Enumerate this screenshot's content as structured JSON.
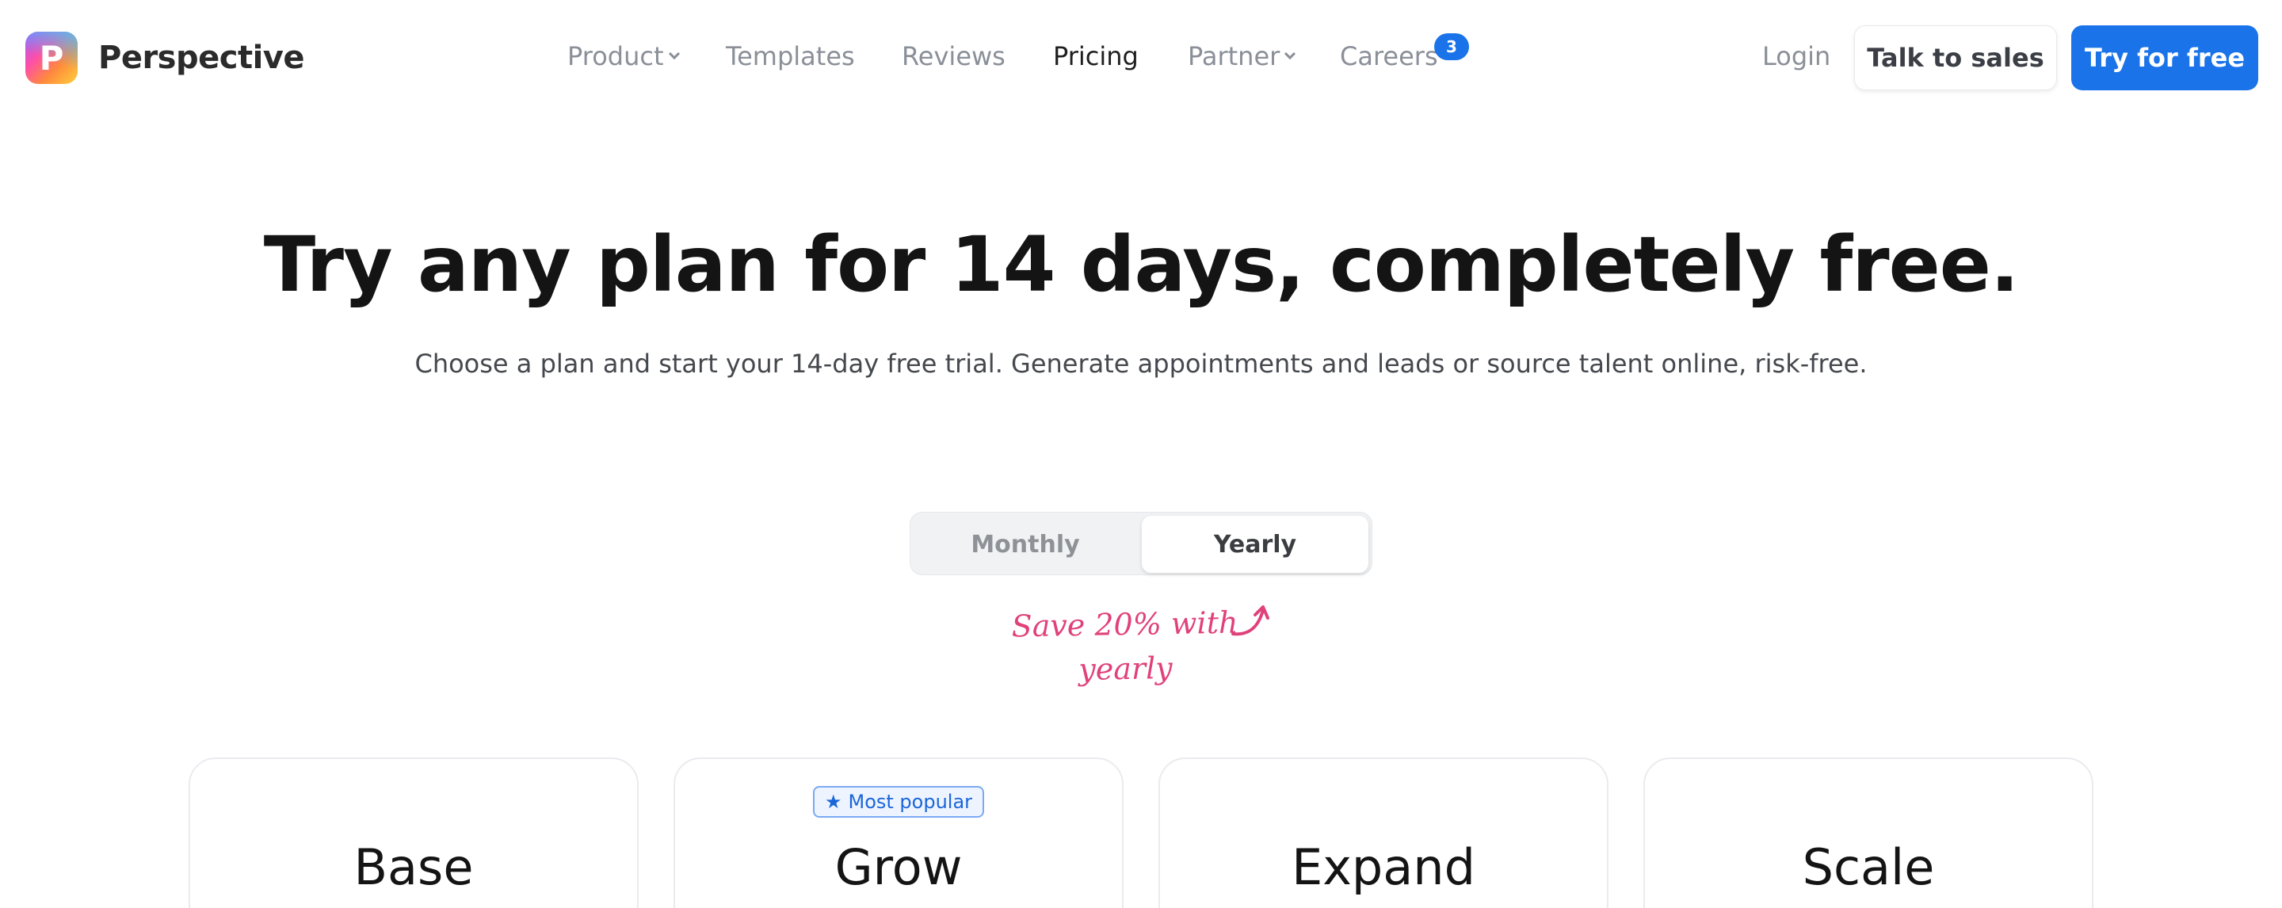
{
  "brand": {
    "name": "Perspective",
    "logo_letter": "P",
    "icon": "perspective-logo-icon"
  },
  "nav": {
    "items": [
      {
        "label": "Product",
        "has_dropdown": true
      },
      {
        "label": "Templates",
        "has_dropdown": false
      },
      {
        "label": "Reviews",
        "has_dropdown": false
      },
      {
        "label": "Pricing",
        "has_dropdown": false,
        "active": true
      },
      {
        "label": "Partner",
        "has_dropdown": true
      },
      {
        "label": "Careers",
        "has_dropdown": false,
        "badge": "3"
      }
    ]
  },
  "actions": {
    "login": "Login",
    "talk_to_sales": "Talk to sales",
    "try_for_free": "Try for free"
  },
  "hero": {
    "title": "Try any plan for 14 days, completely free.",
    "subtitle": "Choose a plan and start your 14-day free trial. Generate appointments and leads or source talent online, risk-free."
  },
  "billing_toggle": {
    "monthly": "Monthly",
    "yearly": "Yearly",
    "selected": "Yearly"
  },
  "save_note": {
    "line1": "Save 20% with",
    "line2": "yearly"
  },
  "plans": [
    {
      "name": "Base"
    },
    {
      "name": "Grow",
      "tag": "Most popular"
    },
    {
      "name": "Expand"
    },
    {
      "name": "Scale"
    }
  ],
  "colors": {
    "accent": "#1a73e8",
    "note": "#e0417a",
    "badge": "#1a73e8"
  }
}
